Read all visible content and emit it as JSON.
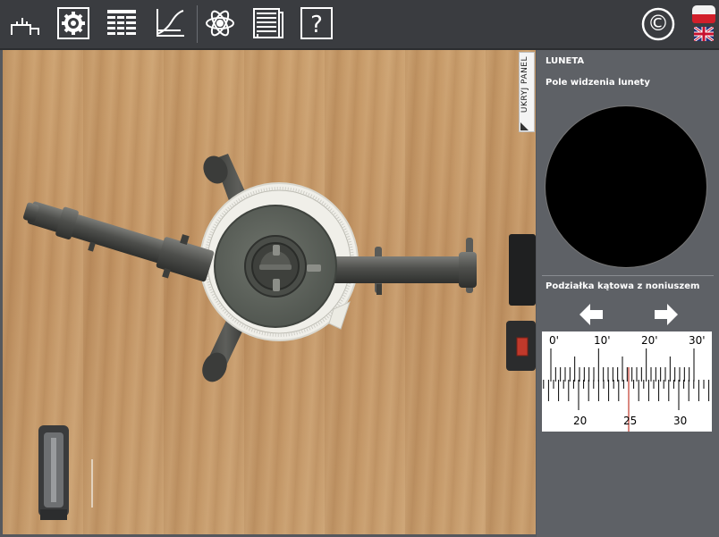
{
  "toolbar": {
    "tools": [
      {
        "name": "setup-icon"
      },
      {
        "name": "settings-icon"
      },
      {
        "name": "table-icon"
      },
      {
        "name": "graph-icon"
      },
      {
        "name": "atom-icon"
      },
      {
        "name": "document-icon"
      },
      {
        "name": "help-icon"
      }
    ],
    "copyright_symbol": "©",
    "languages": [
      "polish-flag-icon",
      "uk-flag-icon"
    ]
  },
  "hide_panel_label": "UKRYJ PANEL",
  "panel": {
    "title": "LUNETA",
    "view_label": "Pole widzenia lunety",
    "scale_label": "Podziałka kątowa z noniuszem",
    "vernier": {
      "top_labels": [
        "0'",
        "10'",
        "20'",
        "30'"
      ],
      "bottom_labels": [
        "20",
        "25",
        "30"
      ],
      "pointer_value": 25
    }
  },
  "colors": {
    "background": "#55585d",
    "toolbar": "#3a3c40",
    "pointer": "#c0392b"
  }
}
